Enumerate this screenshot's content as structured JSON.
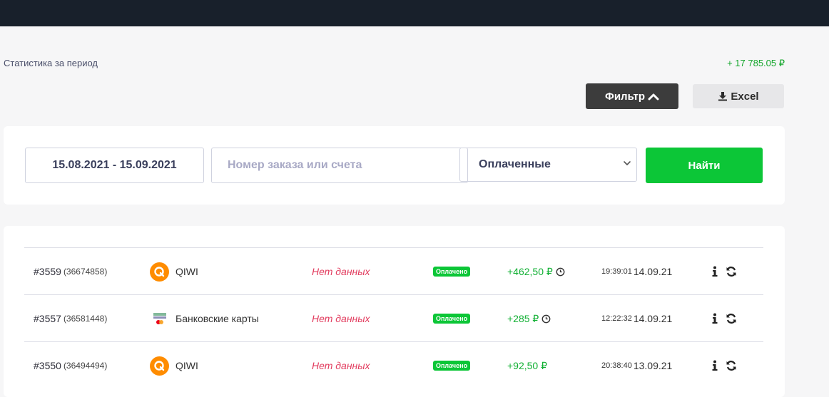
{
  "stats": {
    "label": "Статистика за период",
    "total": "+ 17 785.05 ₽"
  },
  "toolbar": {
    "filter_label": "Фильтр",
    "excel_label": "Excel"
  },
  "filters": {
    "date_range": "15.08.2021 - 15.09.2021",
    "order_placeholder": "Номер заказа или счета",
    "status_selected": "Оплаченные",
    "find_label": "Найти"
  },
  "rows": [
    {
      "order": "#3559",
      "invoice": "(36674858)",
      "method": "QIWI",
      "method_icon": "qiwi-icon",
      "details": "Нет данных",
      "status": "Оплачено",
      "amount": "+462,50 ₽",
      "pending_clock": true,
      "time": "19:39:01",
      "date": "14.09.21"
    },
    {
      "order": "#3557",
      "invoice": "(36581448)",
      "method": "Банковские карты",
      "method_icon": "bank-cards-icon",
      "details": "Нет данных",
      "status": "Оплачено",
      "amount": "+285 ₽",
      "pending_clock": true,
      "time": "12:22:32",
      "date": "14.09.21"
    },
    {
      "order": "#3550",
      "invoice": "(36494494)",
      "method": "QIWI",
      "method_icon": "qiwi-icon",
      "details": "Нет данных",
      "status": "Оплачено",
      "amount": "+92,50 ₽",
      "pending_clock": false,
      "time": "20:38:40",
      "date": "13.09.21"
    }
  ],
  "colors": {
    "accent_green": "#0cc637",
    "topbar": "#18202b",
    "error_red": "#e23d5f",
    "amount_green": "#12b034"
  }
}
